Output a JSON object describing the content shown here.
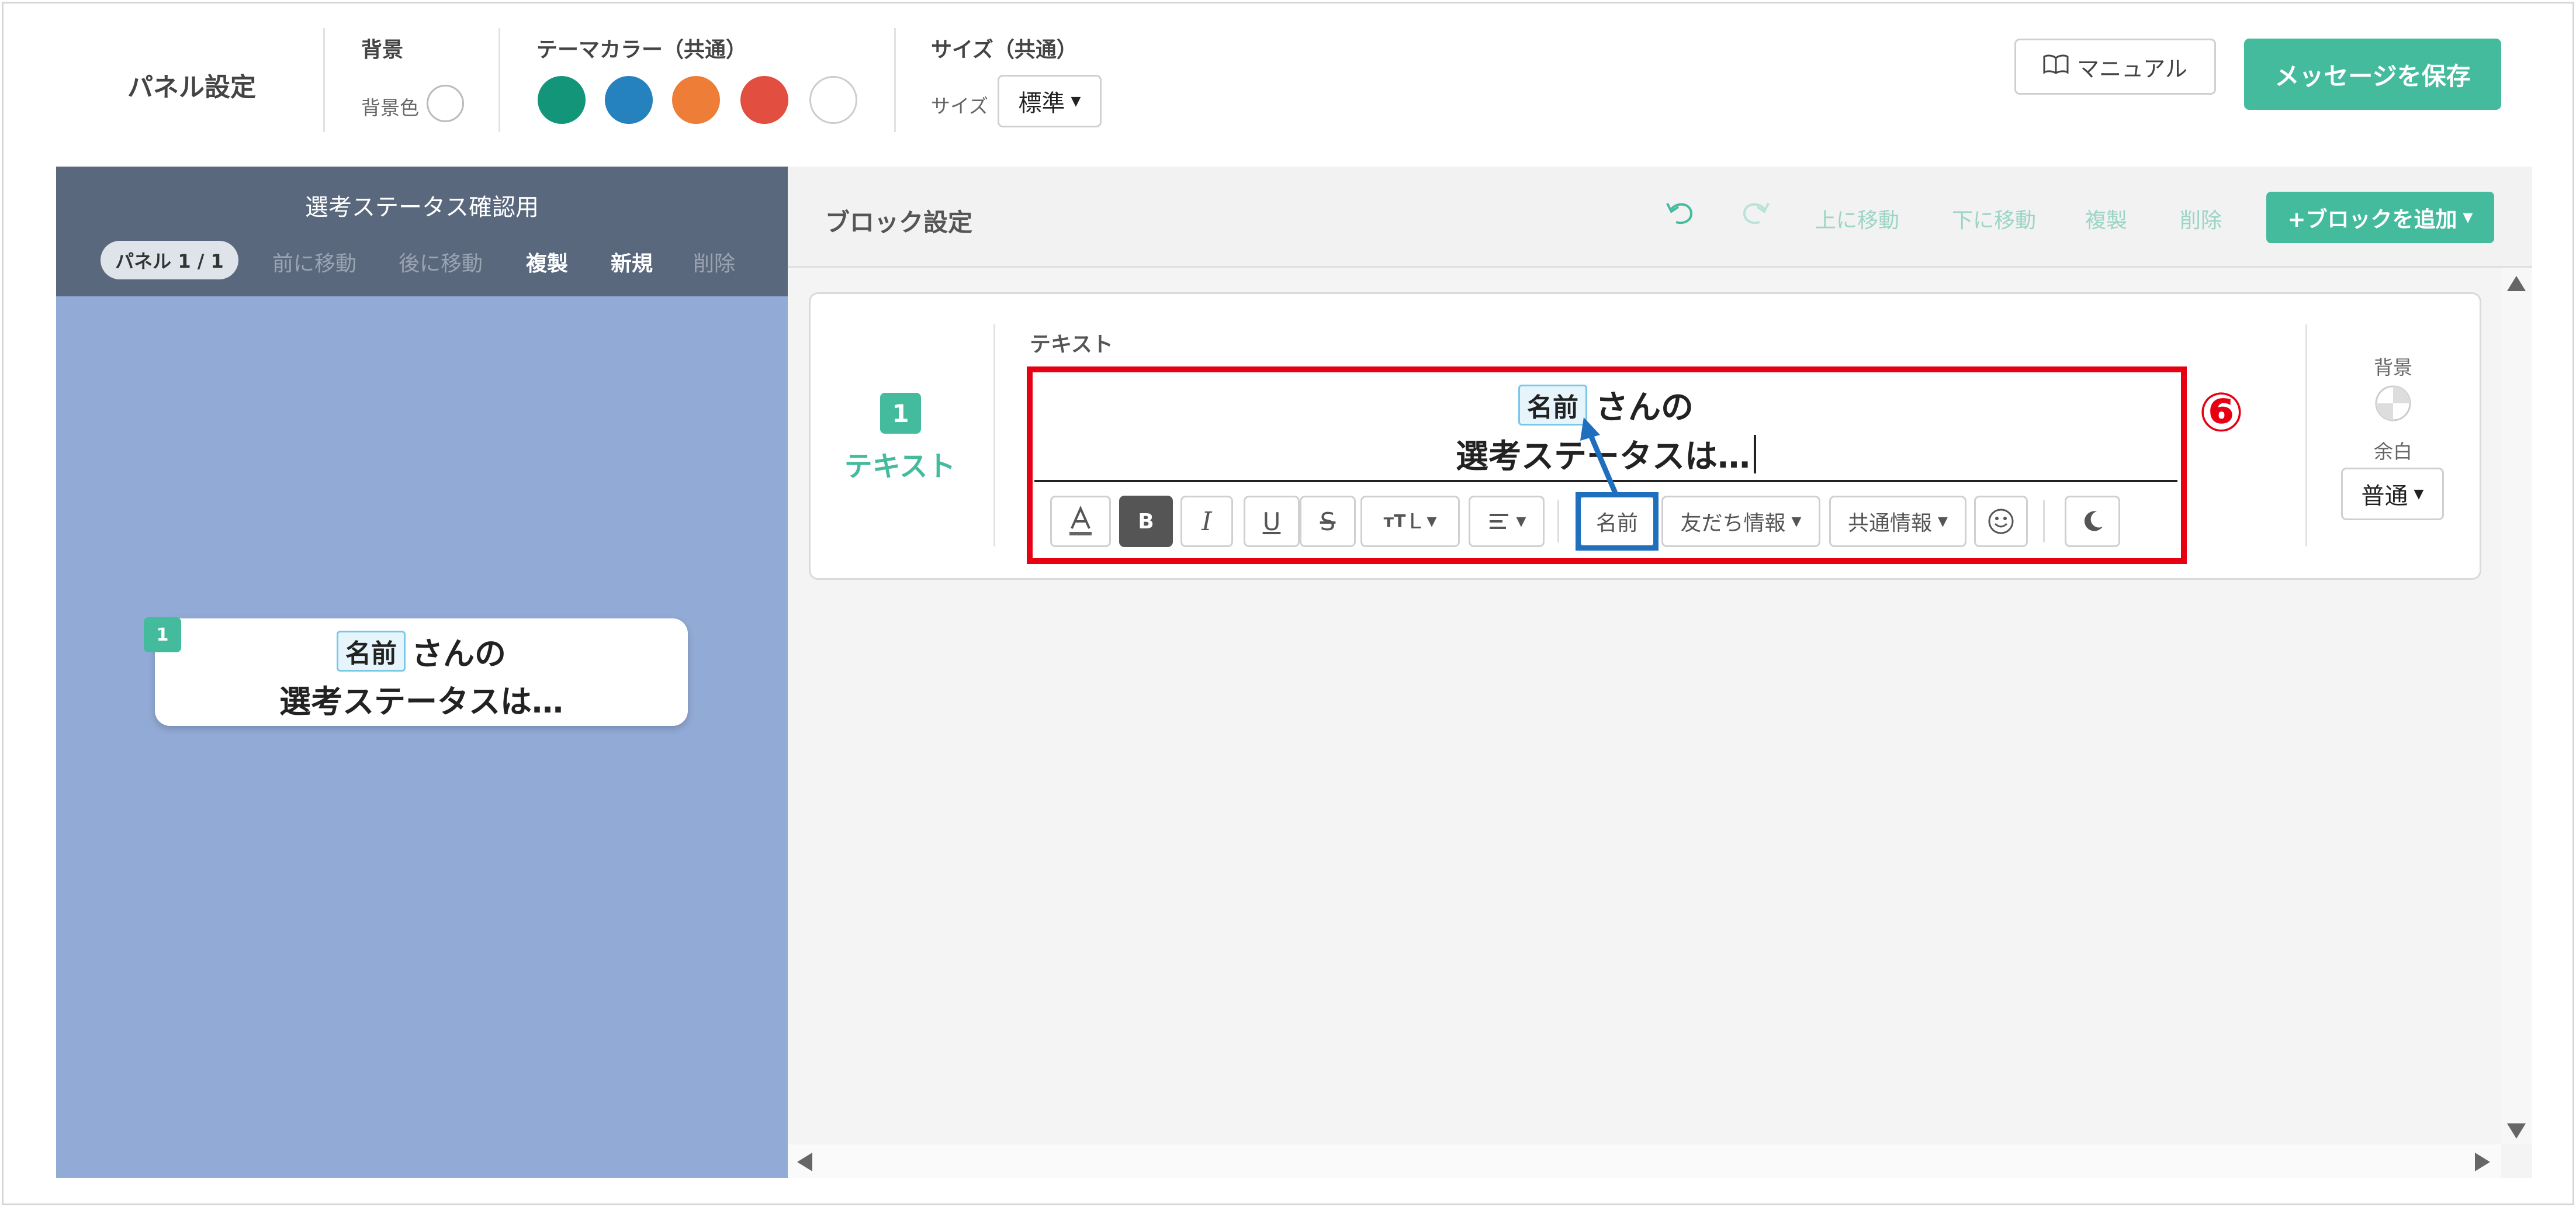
{
  "topbar": {
    "panel_settings": "パネル設定",
    "bg_heading": "背景",
    "bg_color_label": "背景色",
    "theme_heading": "テーマカラー（共通）",
    "theme_colors": [
      "#13957a",
      "#2681bf",
      "#ee7d37",
      "#e24e3f",
      "#ffffff"
    ],
    "size_heading": "サイズ（共通）",
    "size_label": "サイズ",
    "size_value": "標準",
    "manual_label": "マニュアル",
    "save_label": "メッセージを保存"
  },
  "left_panel": {
    "title": "選考ステータス確認用",
    "panel_count": "パネル 1 / 1",
    "move_prev": "前に移動",
    "move_next": "後に移動",
    "duplicate": "複製",
    "new": "新規",
    "delete": "削除",
    "preview": {
      "badge": "1",
      "tag": "名前",
      "line1": "さんの",
      "line2": "選考ステータスは…"
    }
  },
  "block_settings": {
    "title": "ブロック設定",
    "move_up": "上に移動",
    "move_down": "下に移動",
    "duplicate": "複製",
    "delete": "削除",
    "add_block": "+ブロックを追加"
  },
  "block": {
    "number": "1",
    "type_label": "テキスト",
    "field_label": "テキスト",
    "editor_tag": "名前",
    "editor_line1": "さんの",
    "editor_line2": "選考ステータスは…",
    "toolbar": {
      "bold": "B",
      "italic": "I",
      "underline": "U",
      "strike": "S",
      "size_value": "L",
      "name_insert": "名前",
      "friend_info": "友だち情報",
      "common_info": "共通情報"
    },
    "bg_label": "背景",
    "margin_label": "余白",
    "margin_value": "普通"
  },
  "annotation": {
    "step_number": "⑥"
  },
  "colors": {
    "accent": "#45bb9e",
    "left_header_bg": "#5a687e",
    "left_body_bg": "#92aad6",
    "highlight_red": "#e60012",
    "highlight_blue": "#1f6fbf"
  }
}
